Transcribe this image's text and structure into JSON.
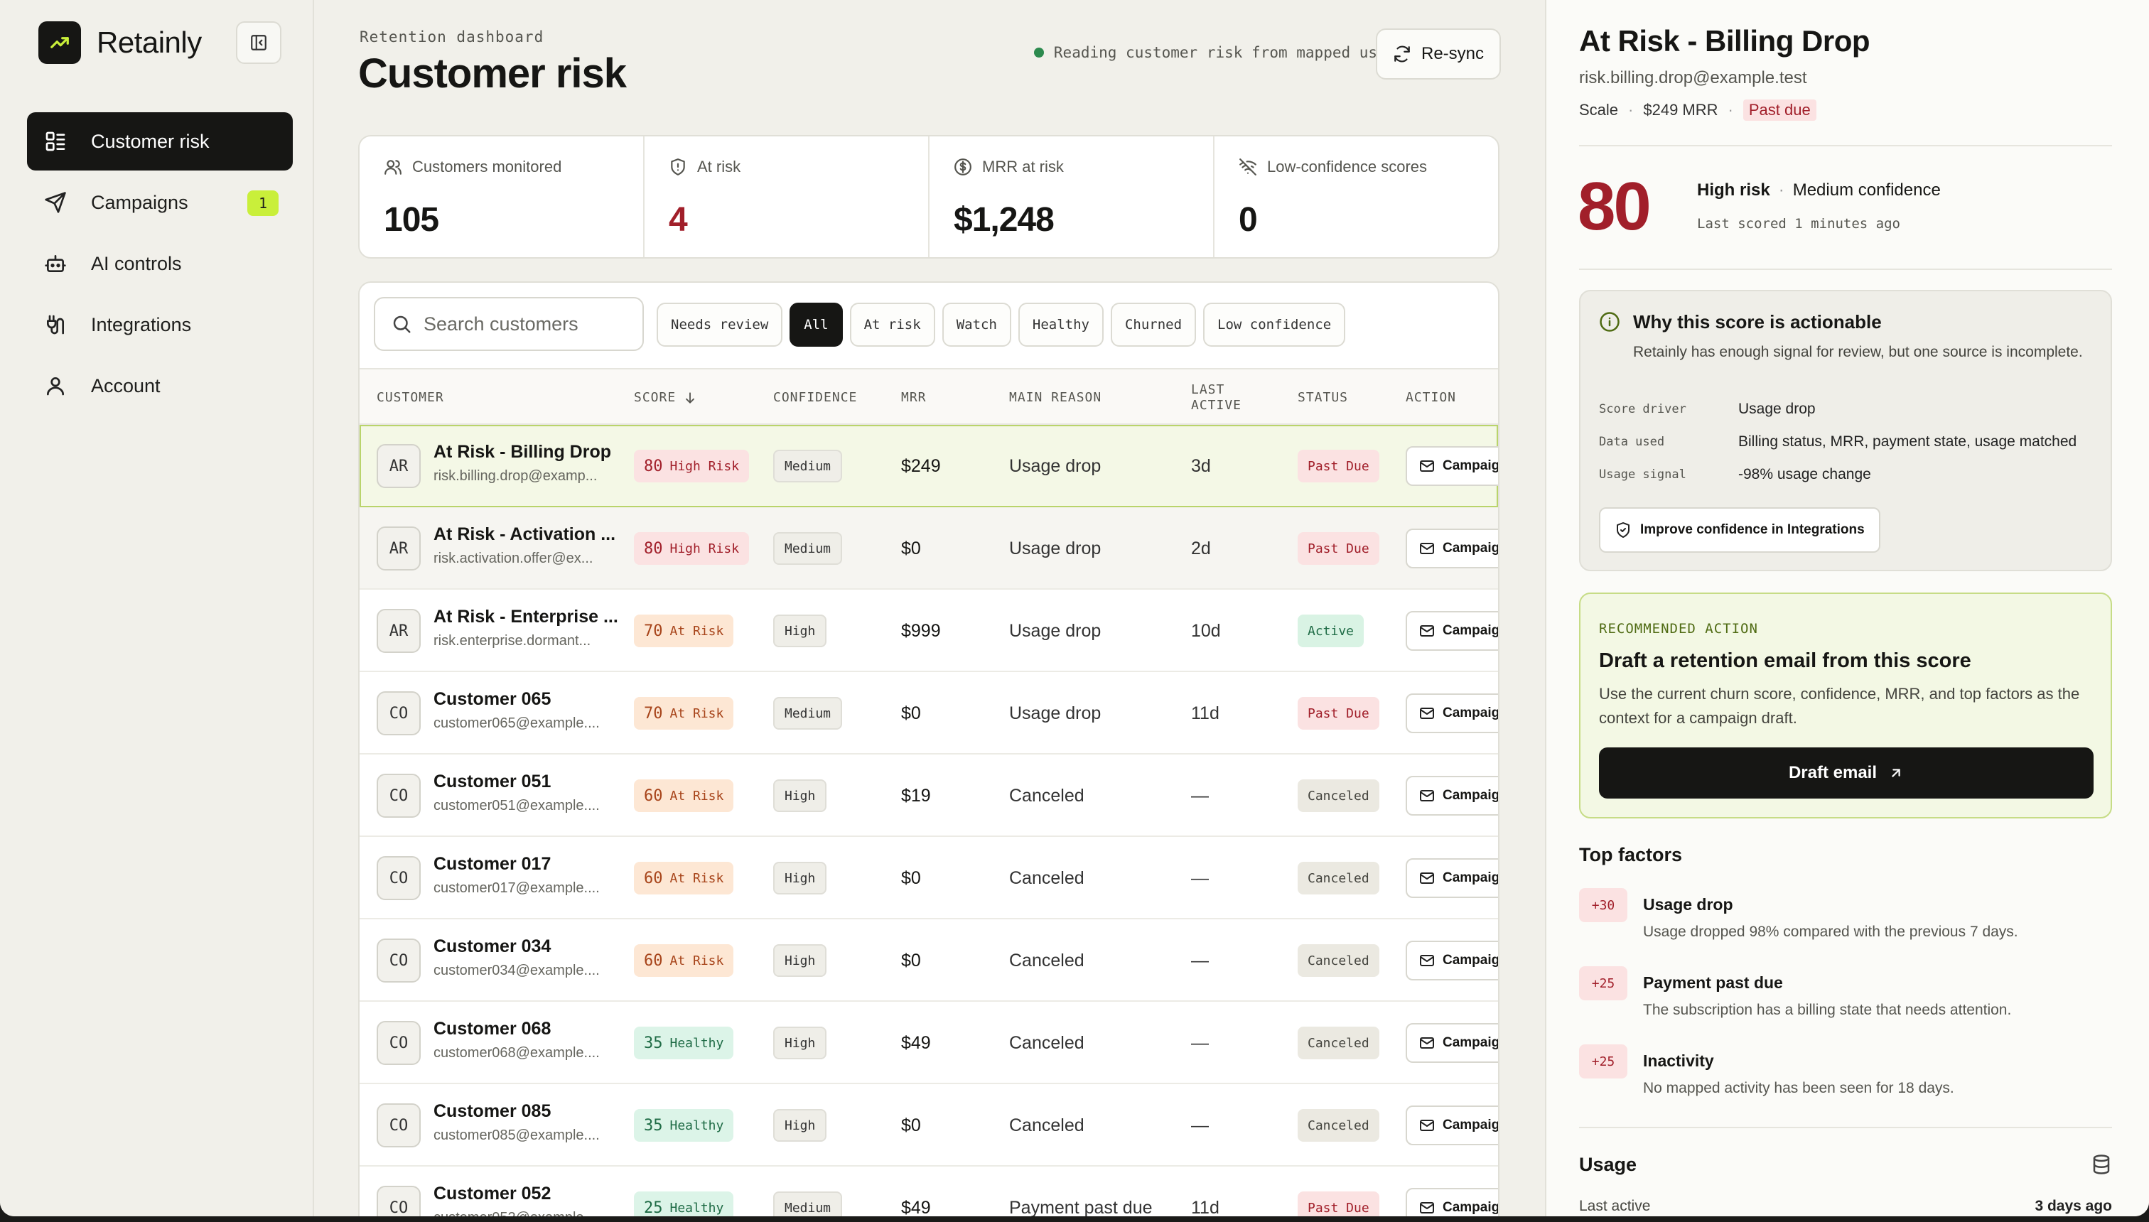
{
  "app": {
    "name": "Retainly"
  },
  "sidebar": {
    "items": [
      {
        "label": "Customer risk",
        "icon": "dashboard-icon",
        "active": true
      },
      {
        "label": "Campaigns",
        "icon": "send-icon",
        "badge": "1"
      },
      {
        "label": "AI controls",
        "icon": "robot-icon"
      },
      {
        "label": "Integrations",
        "icon": "plug-icon"
      },
      {
        "label": "Account",
        "icon": "user-icon"
      }
    ]
  },
  "header": {
    "eyebrow": "Retention dashboard",
    "title": "Customer risk",
    "sync_status": "Reading customer risk from mapped usage",
    "resync_label": "Re-sync"
  },
  "stats": [
    {
      "label": "Customers monitored",
      "value": "105",
      "icon": "users-icon"
    },
    {
      "label": "At risk",
      "value": "4",
      "icon": "shield-icon",
      "color": "#a11f2a"
    },
    {
      "label": "MRR at risk",
      "value": "$1,248",
      "icon": "dollar-icon"
    },
    {
      "label": "Low-confidence scores",
      "value": "0",
      "icon": "wifi-off-icon"
    }
  ],
  "search": {
    "placeholder": "Search customers"
  },
  "filters": [
    "Needs review",
    "All",
    "At risk",
    "Watch",
    "Healthy",
    "Churned",
    "Low confidence"
  ],
  "active_filter": "All",
  "table": {
    "columns": [
      "CUSTOMER",
      "SCORE",
      "CONFIDENCE",
      "MRR",
      "MAIN REASON",
      "LAST ACTIVE",
      "STATUS",
      "ACTION"
    ],
    "action_label": "Campaign",
    "rows": [
      {
        "initials": "AR",
        "name": "At Risk - Billing Drop",
        "email": "risk.billing.drop@examp...",
        "score": "80",
        "score_label": "High Risk",
        "confidence": "Medium",
        "mrr": "$249",
        "reason": "Usage drop",
        "last_active": "3d",
        "status": "Past Due"
      },
      {
        "initials": "AR",
        "name": "At Risk - Activation ...",
        "email": "risk.activation.offer@ex...",
        "score": "80",
        "score_label": "High Risk",
        "confidence": "Medium",
        "mrr": "$0",
        "reason": "Usage drop",
        "last_active": "2d",
        "status": "Past Due"
      },
      {
        "initials": "AR",
        "name": "At Risk - Enterprise ...",
        "email": "risk.enterprise.dormant...",
        "score": "70",
        "score_label": "At Risk",
        "confidence": "High",
        "mrr": "$999",
        "reason": "Usage drop",
        "last_active": "10d",
        "status": "Active"
      },
      {
        "initials": "CO",
        "name": "Customer 065",
        "email": "customer065@example....",
        "score": "70",
        "score_label": "At Risk",
        "confidence": "Medium",
        "mrr": "$0",
        "reason": "Usage drop",
        "last_active": "11d",
        "status": "Past Due"
      },
      {
        "initials": "CO",
        "name": "Customer 051",
        "email": "customer051@example....",
        "score": "60",
        "score_label": "At Risk",
        "confidence": "High",
        "mrr": "$19",
        "reason": "Canceled",
        "last_active": "—",
        "status": "Canceled"
      },
      {
        "initials": "CO",
        "name": "Customer 017",
        "email": "customer017@example....",
        "score": "60",
        "score_label": "At Risk",
        "confidence": "High",
        "mrr": "$0",
        "reason": "Canceled",
        "last_active": "—",
        "status": "Canceled"
      },
      {
        "initials": "CO",
        "name": "Customer 034",
        "email": "customer034@example....",
        "score": "60",
        "score_label": "At Risk",
        "confidence": "High",
        "mrr": "$0",
        "reason": "Canceled",
        "last_active": "—",
        "status": "Canceled"
      },
      {
        "initials": "CO",
        "name": "Customer 068",
        "email": "customer068@example....",
        "score": "35",
        "score_label": "Healthy",
        "confidence": "High",
        "mrr": "$49",
        "reason": "Canceled",
        "last_active": "—",
        "status": "Canceled"
      },
      {
        "initials": "CO",
        "name": "Customer 085",
        "email": "customer085@example....",
        "score": "35",
        "score_label": "Healthy",
        "confidence": "High",
        "mrr": "$0",
        "reason": "Canceled",
        "last_active": "—",
        "status": "Canceled"
      },
      {
        "initials": "CO",
        "name": "Customer 052",
        "email": "customer052@example....",
        "score": "25",
        "score_label": "Healthy",
        "confidence": "Medium",
        "mrr": "$49",
        "reason": "Payment past due",
        "last_active": "11d",
        "status": "Past Due"
      }
    ]
  },
  "panel": {
    "title": "At Risk - Billing Drop",
    "email": "risk.billing.drop@example.test",
    "plan": "Scale",
    "mrr": "$249 MRR",
    "status": "Past due",
    "score": "80",
    "risk": "High risk",
    "confidence": "Medium confidence",
    "last_scored": "Last scored 1 minutes ago",
    "why": {
      "title": "Why this score is actionable",
      "desc": "Retainly has enough signal for review, but one source is incomplete.",
      "rows": [
        {
          "k": "Score driver",
          "v": "Usage drop"
        },
        {
          "k": "Data used",
          "v": "Billing status, MRR, payment state, usage matched"
        },
        {
          "k": "Usage signal",
          "v": "-98% usage change"
        }
      ],
      "button": "Improve confidence in Integrations"
    },
    "recommended": {
      "eyebrow": "RECOMMENDED ACTION",
      "title": "Draft a retention email from this score",
      "desc": "Use the current churn score, confidence, MRR, and top factors as the context for a campaign draft.",
      "button": "Draft email"
    },
    "factors_title": "Top factors",
    "factors": [
      {
        "points": "+30",
        "name": "Usage drop",
        "desc": "Usage dropped 98% compared with the previous 7 days."
      },
      {
        "points": "+25",
        "name": "Payment past due",
        "desc": "The subscription has a billing state that needs attention."
      },
      {
        "points": "+25",
        "name": "Inactivity",
        "desc": "No mapped activity has been seen for 18 days."
      }
    ],
    "usage": {
      "title": "Usage",
      "last_active_label": "Last active",
      "last_active_value": "3 days ago"
    }
  }
}
